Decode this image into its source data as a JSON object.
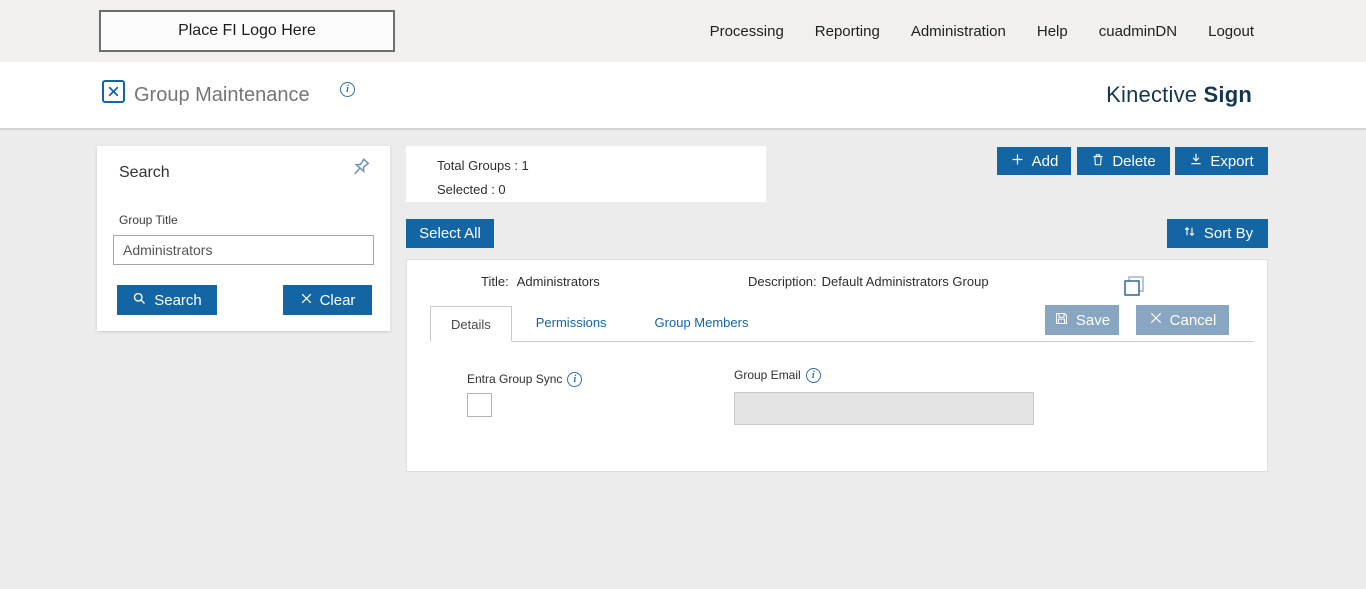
{
  "topbar": {
    "logo_placeholder": "Place FI Logo Here",
    "nav": [
      "Processing",
      "Reporting",
      "Administration",
      "Help",
      "cuadminDN",
      "Logout"
    ]
  },
  "header": {
    "page_title": "Group Maintenance",
    "brand_first": "Kinective",
    "brand_second": "Sign"
  },
  "search_panel": {
    "title": "Search",
    "group_title_label": "Group Title",
    "group_title_value": "Administrators",
    "search_button": "Search",
    "clear_button": "Clear"
  },
  "summary": {
    "total_groups": "Total Groups : 1",
    "selected": "Selected : 0"
  },
  "toolbar": {
    "add": "Add",
    "delete": "Delete",
    "export": "Export",
    "select_all": "Select All",
    "sort_by": "Sort By"
  },
  "group_card": {
    "title_label": "Title:",
    "title_value": "Administrators",
    "description_label": "Description:",
    "description_value": "Default Administrators Group",
    "tabs": [
      "Details",
      "Permissions",
      "Group Members"
    ],
    "save_button": "Save",
    "cancel_button": "Cancel",
    "entra_label": "Entra Group Sync",
    "email_label": "Group Email",
    "email_value": ""
  },
  "colors": {
    "primary_blue": "#1365A4",
    "muted_button_blue": "#88A5C2",
    "brand_navy": "#15374D",
    "page_background": "#ECECEC"
  }
}
